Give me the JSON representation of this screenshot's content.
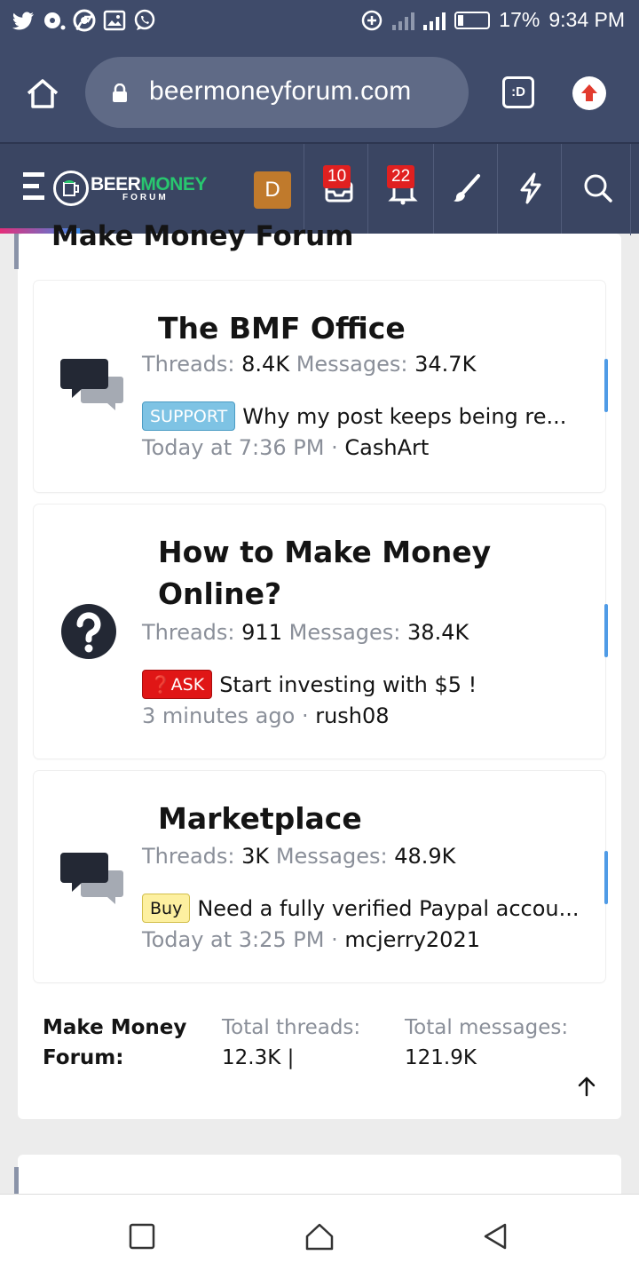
{
  "status_bar": {
    "battery": "17%",
    "time": "9:34 PM",
    "notification_icons": [
      "twitter-icon",
      "record-icon",
      "chrome-icon",
      "gallery-icon",
      "whatsapp-icon"
    ]
  },
  "browser": {
    "url": "beermoneyforum.com",
    "tab_switcher_label": ":D"
  },
  "site_header": {
    "logo_beer": "BEER",
    "logo_money": "MONEY",
    "logo_forum": "FORUM",
    "avatar_letter": "D",
    "inbox_count": "10",
    "alerts_count": "22"
  },
  "block": {
    "title": "Make Money Forum",
    "nodes": [
      {
        "title": "The BMF Office",
        "icon": "chat-bubbles-icon",
        "threads_label": "Threads:",
        "threads": "8.4K",
        "messages_label": "Messages:",
        "messages": "34.7K",
        "prefix": "SUPPORT",
        "latest_title": "Why my post keeps being re...",
        "time": "Today at 7:36 PM",
        "author": "CashArt"
      },
      {
        "title": "How to Make Money Online?",
        "icon": "question-icon",
        "threads_label": "Threads:",
        "threads": "911",
        "messages_label": "Messages:",
        "messages": "38.4K",
        "prefix": "❓ASK",
        "latest_title": "Start investing with $5 !",
        "time": "3 minutes ago",
        "author": "rush08"
      },
      {
        "title": "Marketplace",
        "icon": "chat-bubbles-icon",
        "threads_label": "Threads:",
        "threads": "3K",
        "messages_label": "Messages:",
        "messages": "48.9K",
        "prefix": "Buy",
        "latest_title": "Need a fully verified Paypal accou...",
        "time": "Today at 3:25 PM",
        "author": "mcjerry2021"
      }
    ],
    "footer": {
      "label": "Make Money Forum:",
      "threads_label": "Total threads:",
      "threads_value": "12.3K |",
      "messages_label": "Total messages:",
      "messages_value": "121.9K"
    }
  },
  "colors": {
    "header_bg": "#3a4562",
    "accent_green": "#28c76f",
    "badge_red": "#e02020",
    "unread_blue": "#4f9be6"
  }
}
